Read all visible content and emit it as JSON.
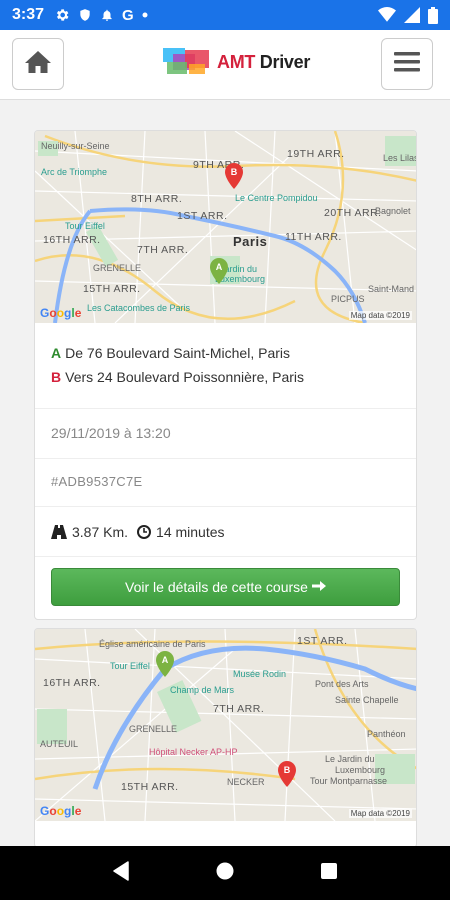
{
  "status_bar": {
    "time": "3:37",
    "g_label": "G"
  },
  "header": {
    "brand_prefix": "AMT",
    "brand_suffix": " Driver"
  },
  "card1": {
    "map": {
      "labels": {
        "neuilly": "Neuilly-sur-Seine",
        "arc": "Arc de Triomphe",
        "arr9": "9TH ARR.",
        "arr19": "19TH ARR.",
        "arr8": "8TH ARR.",
        "arr1": "1ST ARR.",
        "arr20": "20TH ARR.",
        "arr16": "16TH ARR.",
        "arr7": "7TH ARR.",
        "arr11": "11TH ARR.",
        "arr15": "15TH ARR.",
        "paris": "Paris",
        "tour": "Tour Eiffel",
        "pompidou": "Le Centre Pompidou",
        "lux": "Jardin du\nLuxembourg",
        "lux1": "Jardin du",
        "lux2": "Luxembourg",
        "catacombes": "Les Catacombes de Paris",
        "bagnolet": "Bagnolet",
        "lilas": "Les Lilas",
        "grenelle": "GRENELLE",
        "picpus": "PICPUS",
        "saintmande": "Saint-Mand",
        "mapdata": "Map data ©2019"
      }
    },
    "letter_a": "A",
    "letter_b": "B",
    "from": "De 76 Boulevard Saint-Michel, Paris",
    "to": "Vers 24 Boulevard Poissonnière, Paris",
    "datetime": "29/11/2019 à 13:20",
    "ref": "#ADB9537C7E",
    "distance": "3.87 Km.",
    "duration": "14 minutes",
    "cta": "Voir le détails de cette course"
  },
  "card2": {
    "map": {
      "labels": {
        "eglise": "Église américaine de Paris",
        "arr1": "1ST ARR.",
        "tour": "Tour Eiffel",
        "arr16": "16TH ARR.",
        "champ": "Champ de Mars",
        "rodin": "Musée Rodin",
        "pontarts": "Pont des Arts",
        "sainte": "Sainte Chapelle",
        "arr7": "7TH ARR.",
        "grenelle": "GRENELLE",
        "auteuil": "AUTEUIL",
        "necker": "Hôpital Necker AP-HP",
        "arr15": "15TH ARR.",
        "neckerlbl": "NECKER",
        "pantheon": "Panthéon",
        "lux1": "Le Jardin du",
        "lux2": "Luxembourg",
        "montparnasse": "Tour Montparnasse",
        "mapdata": "Map data ©2019"
      }
    }
  },
  "colors": {
    "statusbar": "#1a73e8",
    "cta": "#4cae4c",
    "pin_a": "#7cb342",
    "pin_b": "#e53935",
    "letter_a": "#2e8b2e",
    "letter_b": "#d4213c"
  },
  "icons": [
    "settings-icon",
    "shield-icon",
    "bell-icon",
    "wifi-icon",
    "signal-icon",
    "battery-icon",
    "home-icon",
    "hamburger-menu-icon",
    "road-icon",
    "clock-icon",
    "arrow-right-icon",
    "nav-back-icon",
    "nav-home-icon",
    "nav-recents-icon"
  ]
}
